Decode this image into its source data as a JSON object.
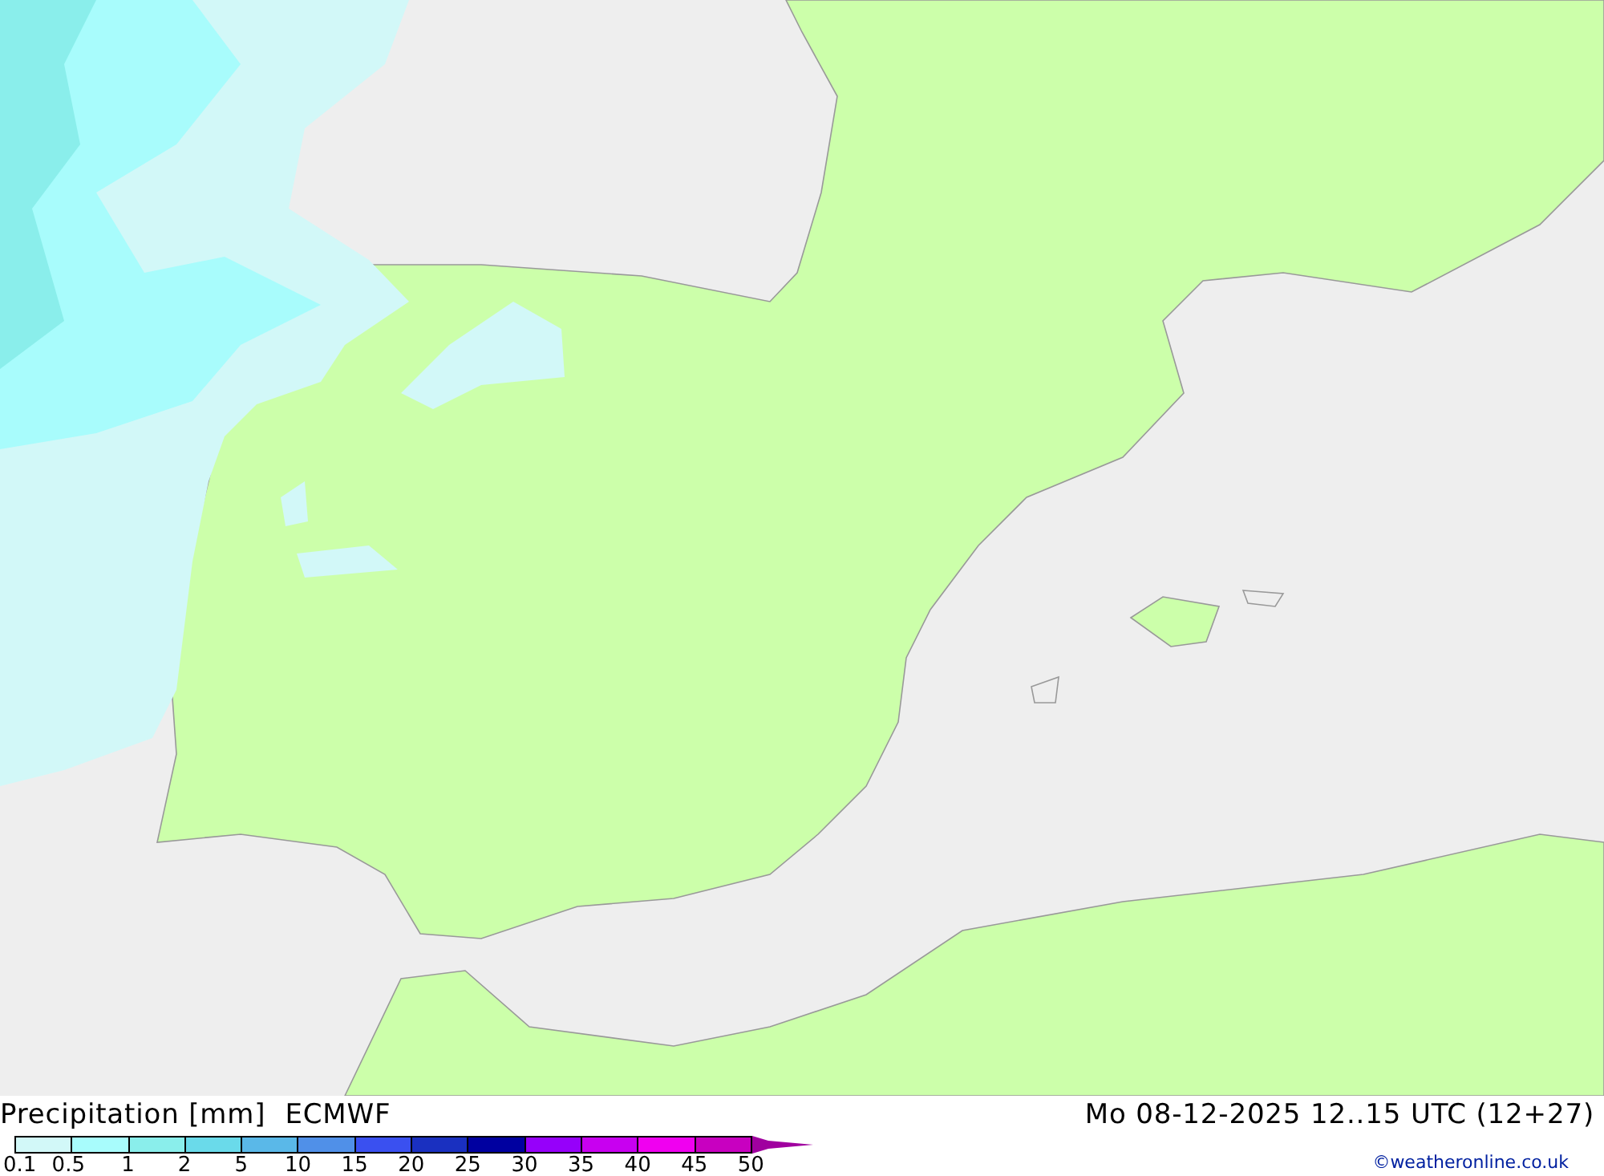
{
  "map": {
    "kind": "precipitation-map"
  },
  "header": {
    "title": "Precipitation [mm]",
    "model": "ECMWF",
    "valid_time": "Mo 08-12-2025 12..15 UTC (12+27)"
  },
  "legend": {
    "bins": [
      {
        "color": "#d2f8f8"
      },
      {
        "color": "#a8fcfc"
      },
      {
        "color": "#8aeeeb"
      },
      {
        "color": "#6adaea"
      },
      {
        "color": "#5ab8e8"
      },
      {
        "color": "#5090e8"
      },
      {
        "color": "#3a50f0"
      },
      {
        "color": "#1a30c0"
      },
      {
        "color": "#0000a0"
      },
      {
        "color": "#9600fa"
      },
      {
        "color": "#c800f0"
      },
      {
        "color": "#f000f0"
      },
      {
        "color": "#c800c0"
      },
      {
        "color": "#a0009f",
        "kind": "arrow"
      }
    ],
    "labels": [
      "0.1",
      "0.5",
      "1",
      "2",
      "5",
      "10",
      "15",
      "20",
      "25",
      "30",
      "35",
      "40",
      "45",
      "50"
    ]
  },
  "credit": "©weatheronline.co.uk"
}
